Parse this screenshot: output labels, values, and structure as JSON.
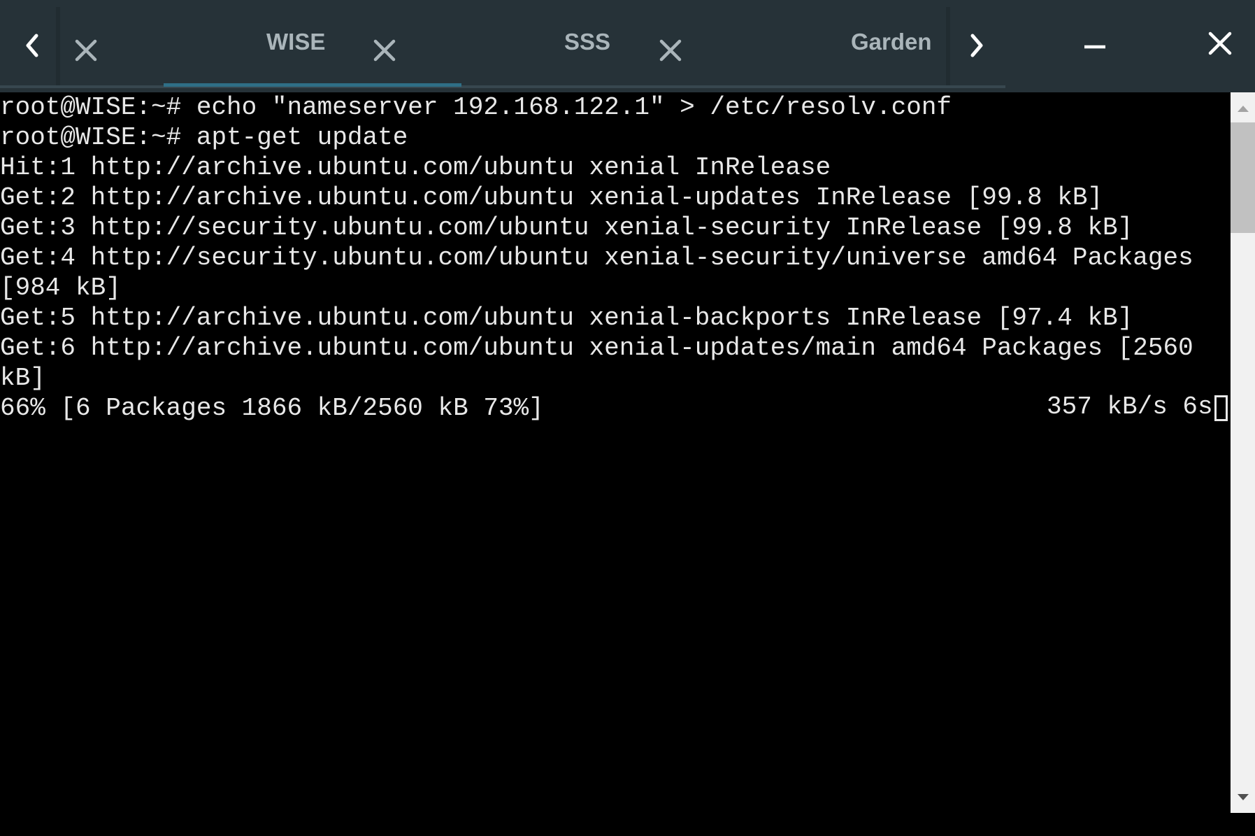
{
  "window": {
    "tabs": [
      {
        "label": "WISE",
        "active": true
      },
      {
        "label": "SSS",
        "active": false
      },
      {
        "label": "Garden",
        "active": false
      }
    ],
    "controls": {
      "scroll_left_icon": "chevron-left-icon",
      "scroll_right_icon": "chevron-right-icon",
      "minimize_icon": "minimize-icon",
      "close_icon": "close-icon"
    },
    "colors": {
      "titlebar": "#263238",
      "tab_text": "#aab5ba",
      "active_indicator": "#2f6f86",
      "terminal_bg": "#000000",
      "terminal_fg": "#e8e8e8"
    }
  },
  "terminal": {
    "lines": [
      "root@WISE:~# echo \"nameserver 192.168.122.1\" > /etc/resolv.conf",
      "root@WISE:~# apt-get update",
      "Hit:1 http://archive.ubuntu.com/ubuntu xenial InRelease",
      "Get:2 http://archive.ubuntu.com/ubuntu xenial-updates InRelease [99.8 kB]",
      "Get:3 http://security.ubuntu.com/ubuntu xenial-security InRelease [99.8 kB]",
      "Get:4 http://security.ubuntu.com/ubuntu xenial-security/universe amd64 Packages",
      "[984 kB]",
      "Get:5 http://archive.ubuntu.com/ubuntu xenial-backports InRelease [97.4 kB]",
      "Get:6 http://archive.ubuntu.com/ubuntu xenial-updates/main amd64 Packages [2560",
      "kB]",
      "66% [6 Packages 1866 kB/2560 kB 73%]"
    ],
    "status_right": "357 kB/s 6s"
  }
}
